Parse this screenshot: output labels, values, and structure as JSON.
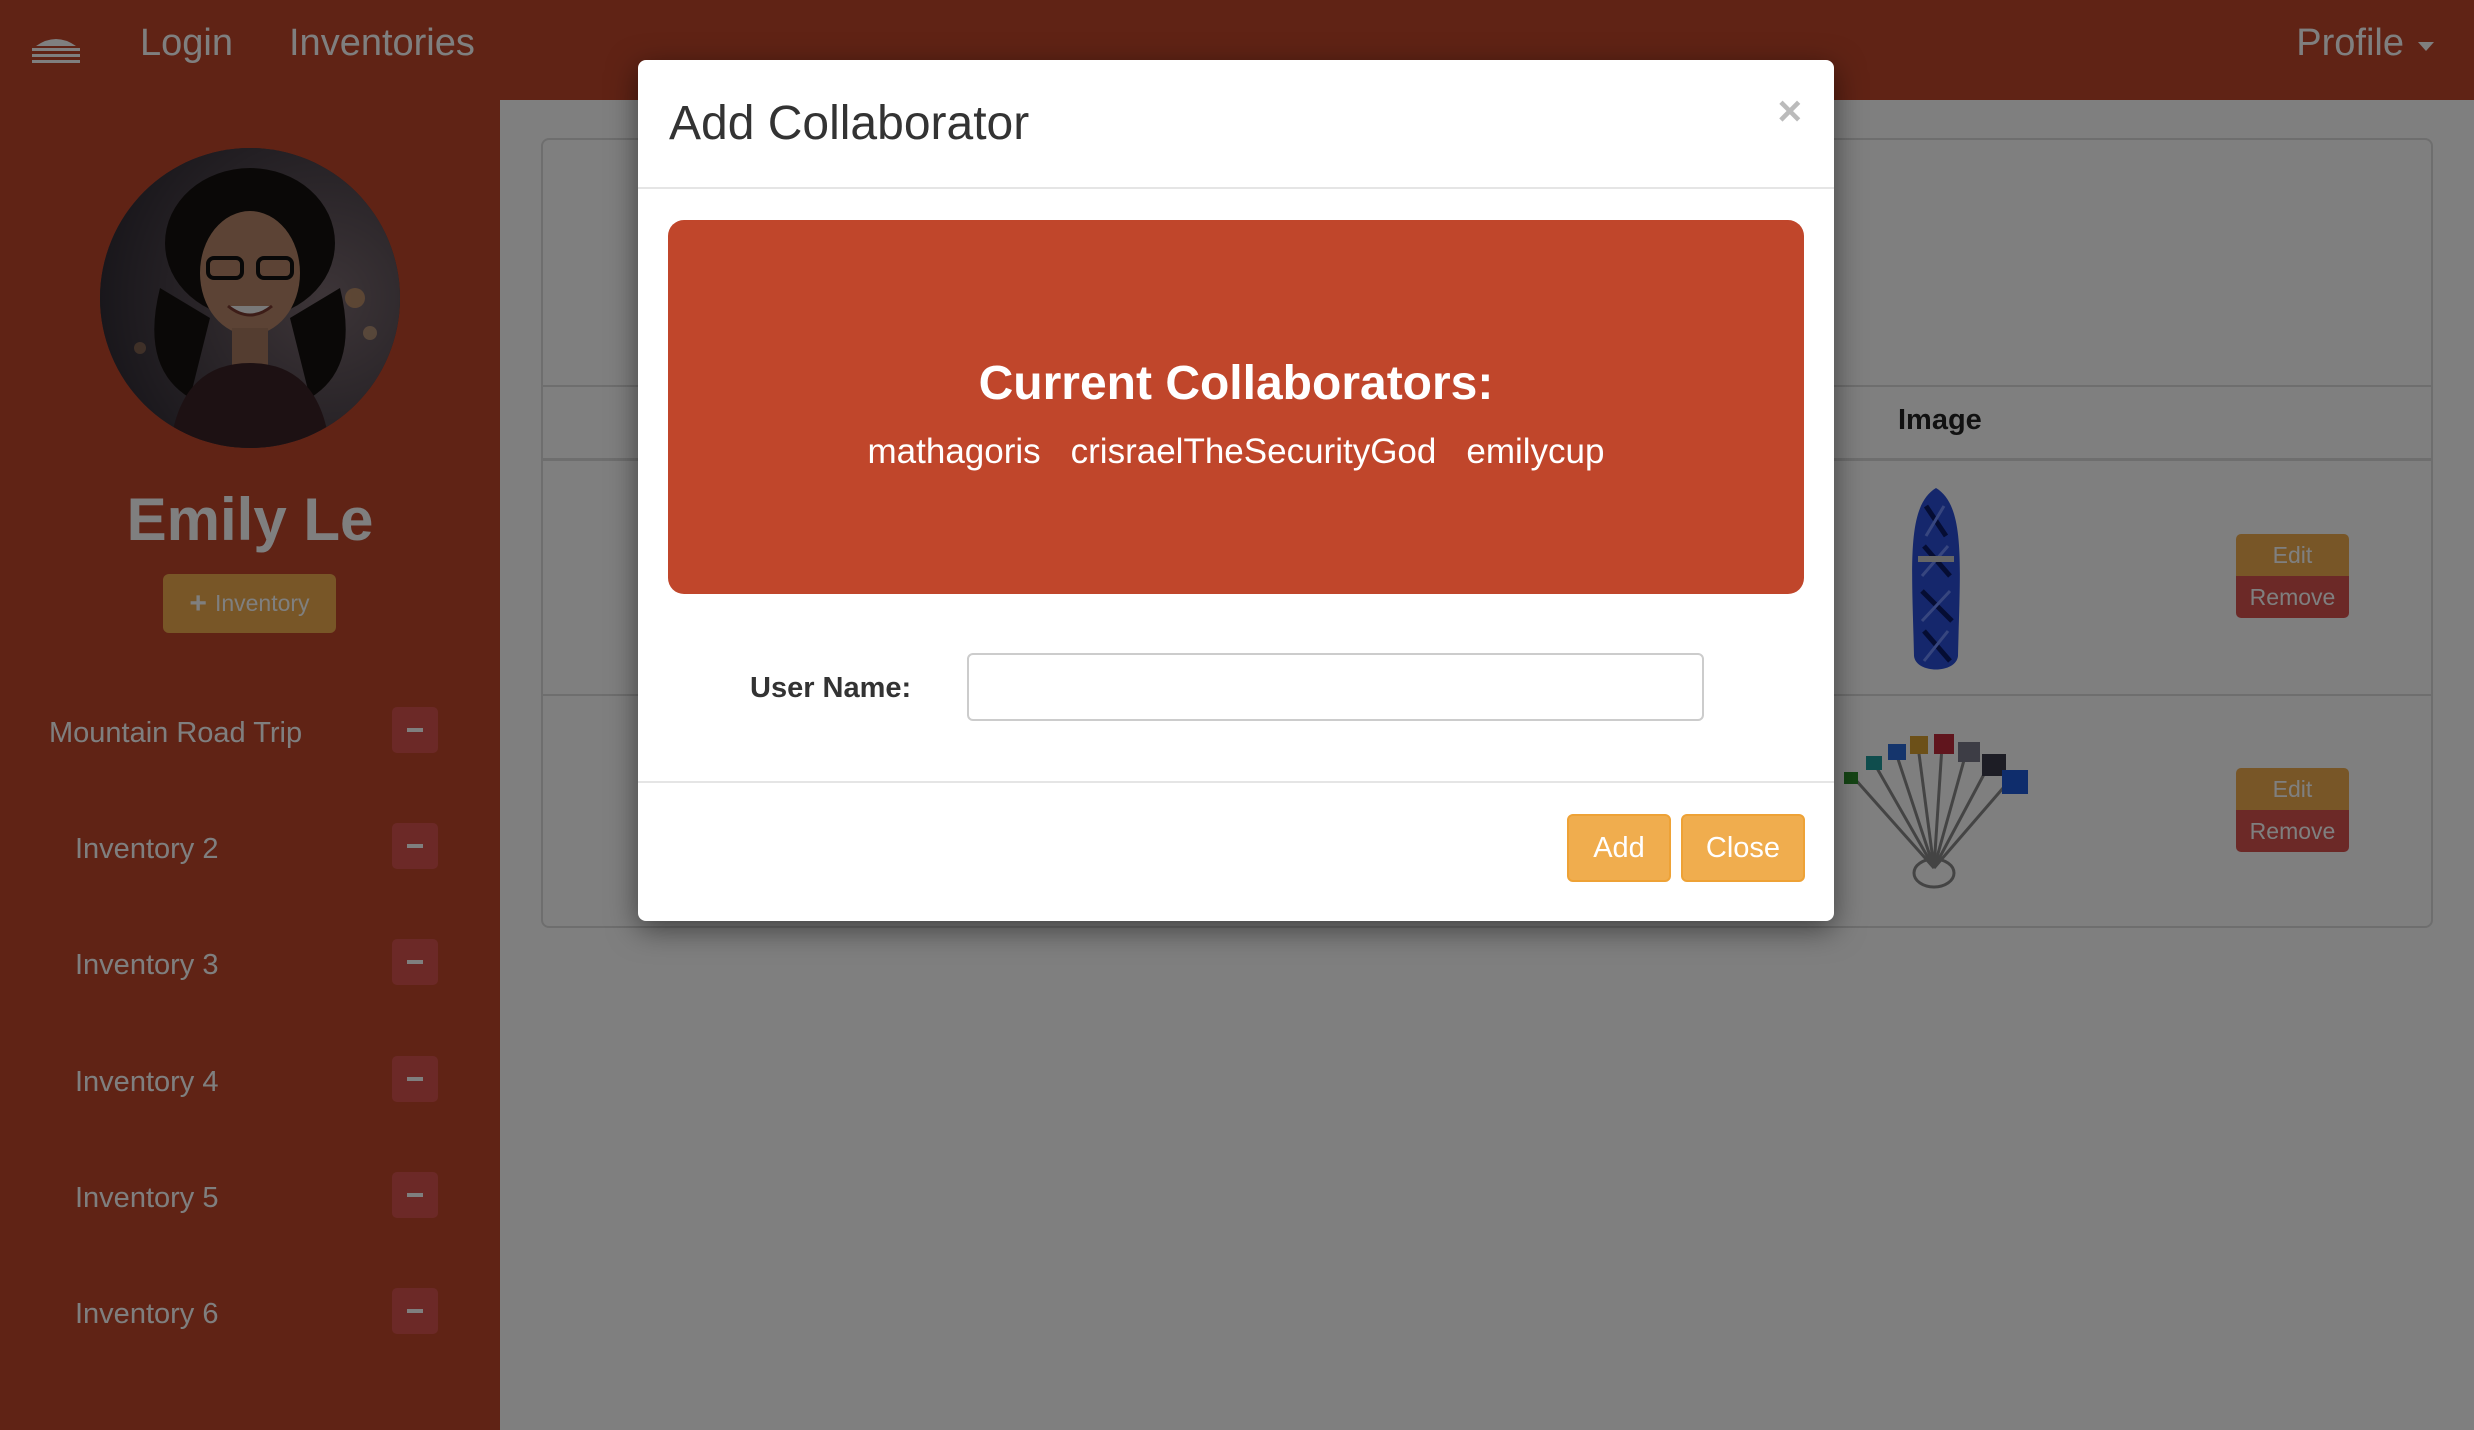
{
  "navbar": {
    "logo_icon": "cloud-stack-logo-icon",
    "login": "Login",
    "inventories": "Inventories",
    "profile": "Profile"
  },
  "sidebar": {
    "user_name": "Emily Le",
    "add_inventory_label": "Inventory",
    "inventories": [
      {
        "label": "Mountain Road Trip"
      },
      {
        "label": "Inventory 2"
      },
      {
        "label": "Inventory 3"
      },
      {
        "label": "Inventory 4"
      },
      {
        "label": "Inventory 5"
      },
      {
        "label": "Inventory 6"
      }
    ]
  },
  "table": {
    "image_header": "Image",
    "rows": [
      {
        "image": "rope-image",
        "edit": "Edit",
        "remove": "Remove"
      },
      {
        "image": "climbing-nuts-image",
        "edit": "Edit",
        "remove": "Remove"
      }
    ]
  },
  "modal": {
    "title": "Add Collaborator",
    "close_symbol": "×",
    "collaborators_title": "Current Collaborators:",
    "collaborators": [
      "mathagoris",
      "crisraelTheSecurityGod",
      "emilycup"
    ],
    "username_label": "User Name:",
    "username_value": "",
    "username_placeholder": "",
    "add_label": "Add",
    "close_label": "Close"
  },
  "colors": {
    "brand": "#c0462b",
    "warning": "#f0ad4e",
    "danger": "#d9534f"
  }
}
